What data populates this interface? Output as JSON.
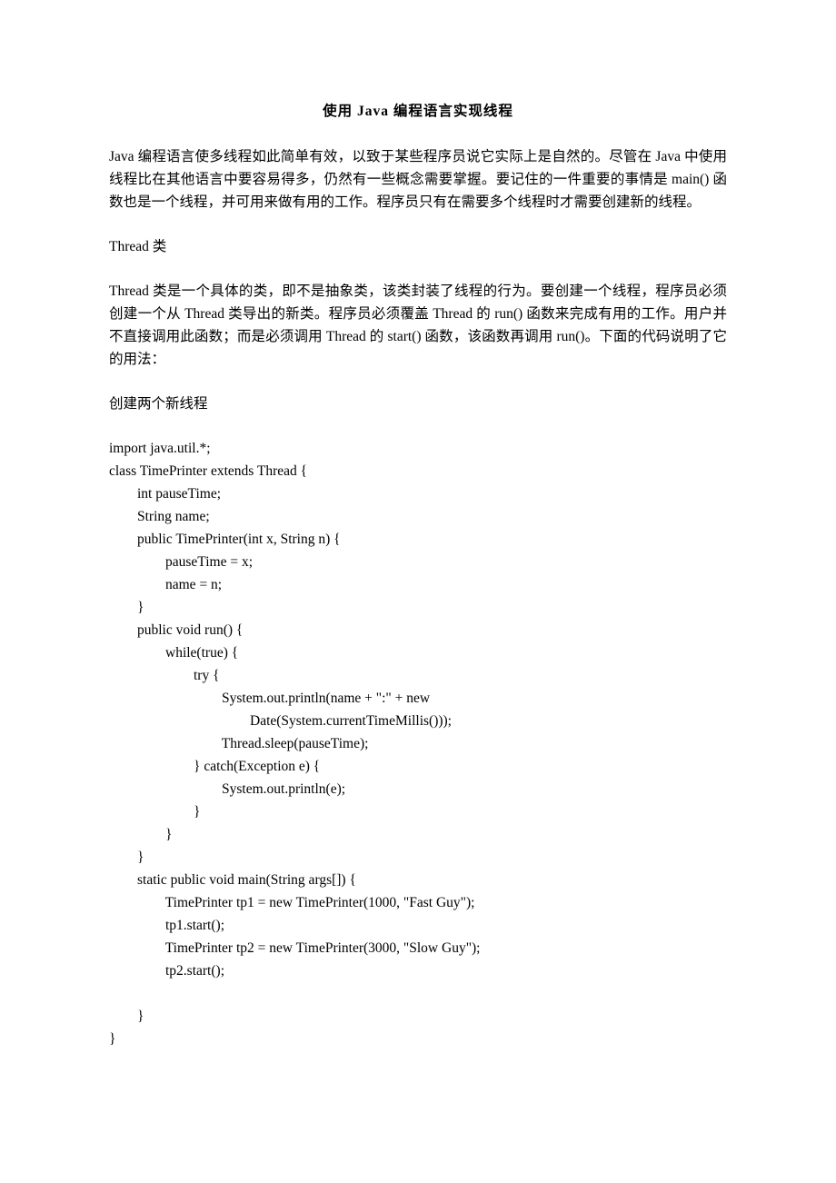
{
  "title": "使用 Java 编程语言实现线程",
  "paragraphs": {
    "intro": "Java 编程语言使多线程如此简单有效，以致于某些程序员说它实际上是自然的。尽管在 Java 中使用线程比在其他语言中要容易得多，仍然有一些概念需要掌握。要记住的一件重要的事情是 main() 函数也是一个线程，并可用来做有用的工作。程序员只有在需要多个线程时才需要创建新的线程。",
    "threadClassHeading": "Thread 类",
    "threadClassBody": "Thread 类是一个具体的类，即不是抽象类，该类封装了线程的行为。要创建一个线程，程序员必须创建一个从 Thread 类导出的新类。程序员必须覆盖 Thread 的 run() 函数来完成有用的工作。用户并不直接调用此函数；而是必须调用 Thread 的 start() 函数，该函数再调用 run()。下面的代码说明了它的用法：",
    "createTwoThreads": "创建两个新线程"
  },
  "code": {
    "line1": "import java.util.*;",
    "line2": "class TimePrinter extends Thread {",
    "line3": "        int pauseTime;",
    "line4": "        String name;",
    "line5": "        public TimePrinter(int x, String n) {",
    "line6": "                pauseTime = x;",
    "line7": "                name = n;",
    "line8": "        }",
    "line9": "        public void run() {",
    "line10": "                while(true) {",
    "line11": "                        try {",
    "line12": "                                System.out.println(name + \":\" + new",
    "line13": "                                        Date(System.currentTimeMillis()));",
    "line14": "                                Thread.sleep(pauseTime);",
    "line15": "                        } catch(Exception e) {",
    "line16": "                                System.out.println(e);",
    "line17": "                        }",
    "line18": "                }",
    "line19": "        }",
    "line20": "        static public void main(String args[]) {",
    "line21": "                TimePrinter tp1 = new TimePrinter(1000, \"Fast Guy\");",
    "line22": "                tp1.start();",
    "line23": "                TimePrinter tp2 = new TimePrinter(3000, \"Slow Guy\");",
    "line24": "                tp2.start();",
    "line25": "",
    "line26": "        }",
    "line27": "}"
  }
}
